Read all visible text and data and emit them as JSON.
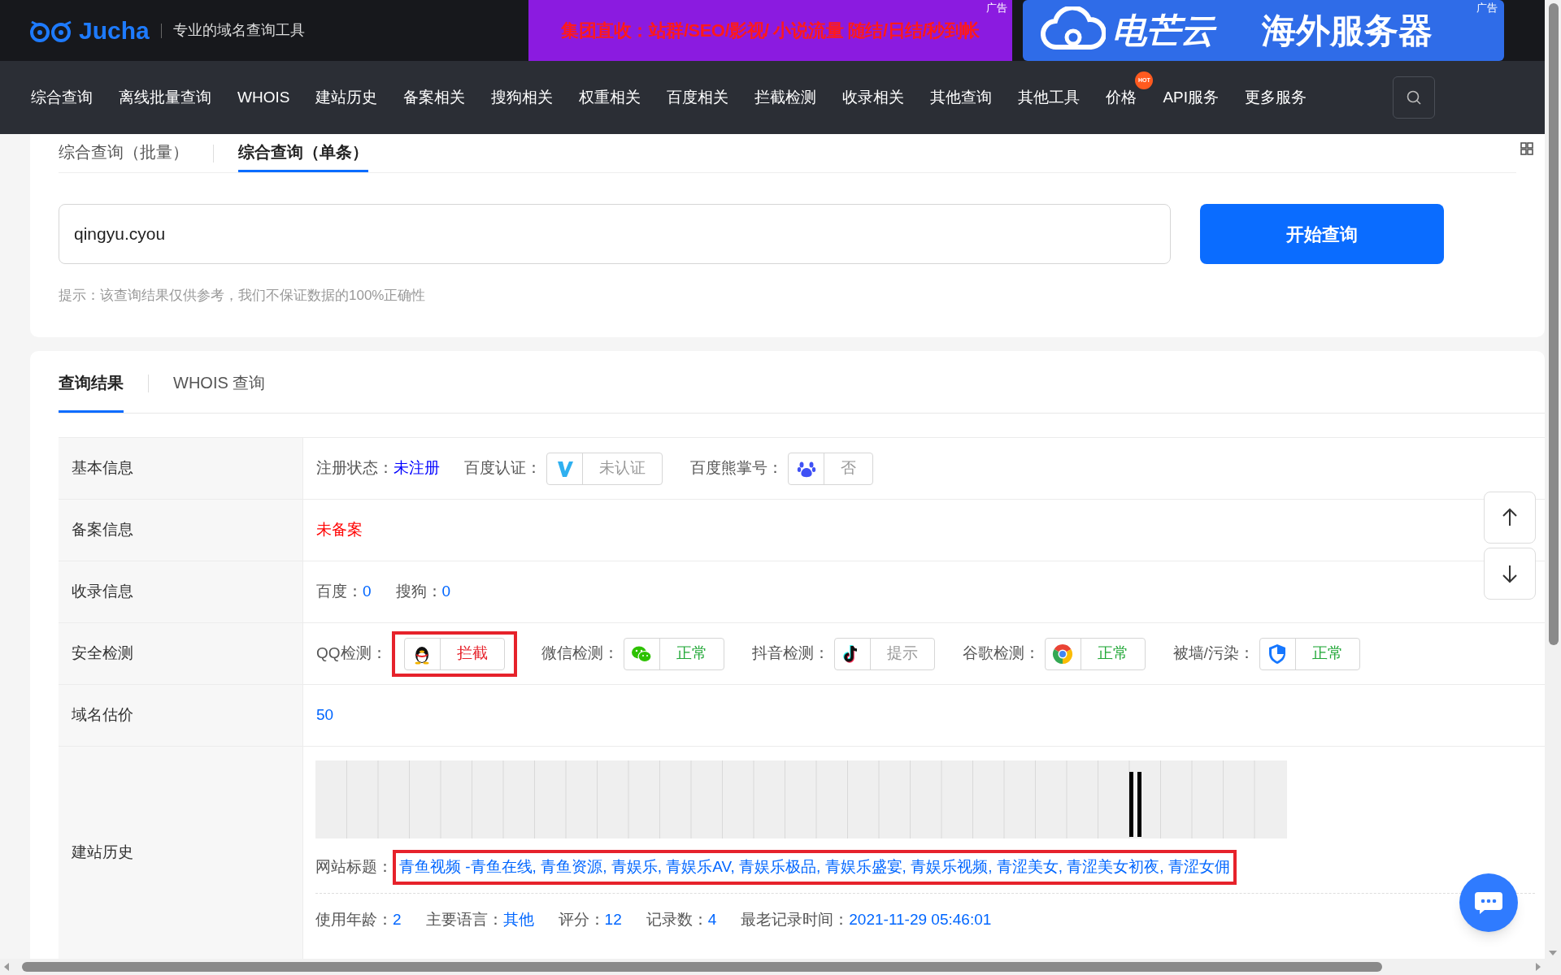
{
  "header": {
    "logo": "Jucha",
    "slogan": "专业的域名查询工具",
    "ads": [
      {
        "text": "集团直收：站群/SEO/影视/ 小说流量 随结/日结/秒到帐",
        "label": "广告"
      },
      {
        "brand": "电芒云",
        "text": "海外服务器",
        "label": "广告"
      }
    ]
  },
  "nav": [
    {
      "label": "综合查询"
    },
    {
      "label": "离线批量查询"
    },
    {
      "label": "WHOIS"
    },
    {
      "label": "建站历史"
    },
    {
      "label": "备案相关"
    },
    {
      "label": "搜狗相关"
    },
    {
      "label": "权重相关"
    },
    {
      "label": "百度相关"
    },
    {
      "label": "拦截检测"
    },
    {
      "label": "收录相关"
    },
    {
      "label": "其他查询"
    },
    {
      "label": "其他工具"
    },
    {
      "label": "价格",
      "badge": "HOT"
    },
    {
      "label": "API服务"
    },
    {
      "label": "更多服务"
    }
  ],
  "query_tabs": [
    {
      "label": "综合查询（批量）",
      "selected": false
    },
    {
      "label": "综合查询（单条）",
      "selected": true
    }
  ],
  "search": {
    "value": "qingyu.cyou",
    "button": "开始查询",
    "hint": "提示：该查询结果仅供参考，我们不保证数据的100%正确性"
  },
  "result_tabs": [
    {
      "label": "查询结果",
      "selected": true
    },
    {
      "label": "WHOIS 查询",
      "selected": false
    }
  ],
  "rows": [
    {
      "label": "基本信息",
      "items": [
        {
          "kind": "value",
          "name": "注册状态：",
          "value": "未注册",
          "color": "#0000ff"
        },
        {
          "kind": "badge",
          "name": "百度认证：",
          "status": "未认证",
          "color": "#999999",
          "highlighted": false
        },
        {
          "kind": "badge",
          "name": "百度熊掌号：",
          "status": "否",
          "color": "#999999",
          "highlighted": false
        }
      ]
    },
    {
      "label": "备案信息",
      "items": [
        {
          "kind": "value",
          "value": "未备案",
          "color": "#ff0000"
        }
      ]
    },
    {
      "label": "收录信息",
      "items": [
        {
          "kind": "value",
          "name": "百度：",
          "value": "0",
          "color": "#0066ff"
        },
        {
          "kind": "value",
          "name": "搜狗：",
          "value": "0",
          "color": "#0066ff"
        }
      ]
    },
    {
      "label": "安全检测",
      "items": [
        {
          "kind": "badge",
          "name": "QQ检测：",
          "status": "拦截",
          "color": "#e6222b",
          "highlighted": true
        },
        {
          "kind": "badge",
          "name": "微信检测：",
          "status": "正常",
          "color": "#22a838",
          "highlighted": false
        },
        {
          "kind": "badge",
          "name": "抖音检测：",
          "status": "提示",
          "color": "#999999",
          "highlighted": false
        },
        {
          "kind": "badge",
          "name": "谷歌检测：",
          "status": "正常",
          "color": "#22a838",
          "highlighted": false
        },
        {
          "kind": "badge",
          "name": "被墙/污染：",
          "status": "正常",
          "color": "#22a838",
          "highlighted": false
        }
      ]
    },
    {
      "label": "域名估价",
      "items": [
        {
          "kind": "value",
          "value": "50",
          "color": "#0066ff"
        }
      ]
    }
  ],
  "history": {
    "label": "建站历史",
    "title_name": "网站标题：",
    "title": "青鱼视频 -青鱼在线, 青鱼资源, 青娱乐, 青娱乐AV, 青娱乐极品, 青娱乐盛宴, 青娱乐视频, 青涩美女, 青涩美女初夜, 青涩女佣",
    "title_highlighted": true,
    "stats": [
      {
        "name": "使用年龄：",
        "value": "2"
      },
      {
        "name": "主要语言：",
        "value": "其他"
      },
      {
        "name": "评分：",
        "value": "12"
      },
      {
        "name": "记录数：",
        "value": "4"
      },
      {
        "name": "最老记录时间：",
        "value": "2021-11-29 05:46:01"
      }
    ]
  }
}
